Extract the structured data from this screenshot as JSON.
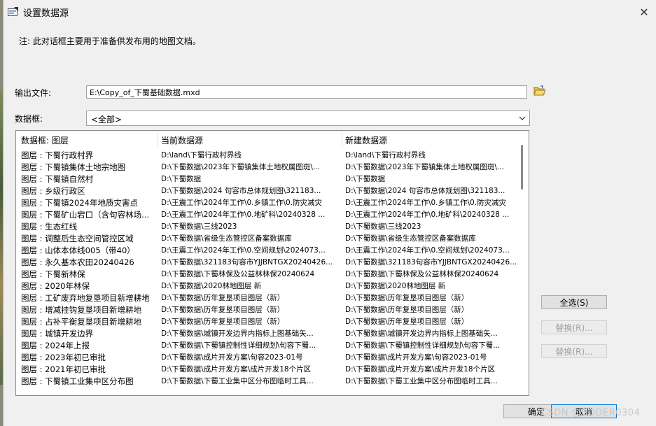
{
  "window": {
    "title": "设置数据源",
    "close_icon": "close-icon"
  },
  "note": "注: 此对话框主要用于准备供发布用的地图文档。",
  "output_file": {
    "label": "输出文件:",
    "value": "E:\\Copy_of_下蜀基础数据.mxd"
  },
  "data_frame": {
    "label": "数据框:",
    "value": "<全部>"
  },
  "table": {
    "columns": [
      "数据框: 图层",
      "当前数据源",
      "新建数据源"
    ],
    "rows": [
      [
        "图层 : 下蜀行政村界",
        "D:\\land\\下蜀行政村界线",
        "D:\\land\\下蜀行政村界线"
      ],
      [
        "图层 : 下蜀镇集体土地宗地图",
        "D:\\下蜀数据\\2023年下蜀镇集体土地权属图斑\\...",
        "D:\\下蜀数据\\2023年下蜀镇集体土地权属图斑\\..."
      ],
      [
        "图层 : 下蜀镇自然村",
        "D:\\下蜀数据",
        "D:\\下蜀数据"
      ],
      [
        "图层 : 乡级行政区",
        "D:\\下蜀数据\\2024 句容市总体规划图\\321183...",
        "D:\\下蜀数据\\2024 句容市总体规划图\\321183..."
      ],
      [
        "图层 : 下蜀镇2024年地质灾害点",
        "D:\\王震工作\\2024年工作\\0.乡镇工作\\0.防灾减灾",
        "D:\\王震工作\\2024年工作\\0.乡镇工作\\0.防灾减灾"
      ],
      [
        "图层 : 下蜀矿山宕口（含句容林场...",
        "D:\\王震工作\\2024年工作\\0.地矿科\\20240328 ...",
        "D:\\王震工作\\2024年工作\\0.地矿科\\20240328 ..."
      ],
      [
        "图层 : 生态红线",
        "D:\\下蜀数据\\三线2023",
        "D:\\下蜀数据\\三线2023"
      ],
      [
        "图层 : 调整后生态空间管控区域",
        "D:\\下蜀数据\\省级生态管控区备案数据库",
        "D:\\下蜀数据\\省级生态管控区备案数据库"
      ],
      [
        "图层 : 山体本体线005（带40）",
        "D:\\王震工作\\2024年工作\\0.空间规划\\2024073...",
        "D:\\王震工作\\2024年工作\\0.空间规划\\2024073..."
      ],
      [
        "图层 : 永久基本农田20240426",
        "D:\\下蜀数据\\321183句容市YJJBNTGX20240426...",
        "D:\\下蜀数据\\321183句容市YJJBNTGX20240426..."
      ],
      [
        "图层 : 下蜀新林保",
        "D:\\下蜀数据\\下蜀林保及公益林林保20240624",
        "D:\\下蜀数据\\下蜀林保及公益林林保20240624"
      ],
      [
        "图层 : 2020年林保",
        "D:\\下蜀数据\\2020林地图层 新",
        "D:\\下蜀数据\\2020林地图层 新"
      ],
      [
        "图层 : 工矿废弃地复垦项目新增耕地",
        "D:\\下蜀数据\\历年复垦项目图层（新）",
        "D:\\下蜀数据\\历年复垦项目图层（新）"
      ],
      [
        "图层 : 增减挂钩复垦项目新增耕地",
        "D:\\下蜀数据\\历年复垦项目图层（新）",
        "D:\\下蜀数据\\历年复垦项目图层（新）"
      ],
      [
        "图层 : 占补平衡复垦项目新增耕地",
        "D:\\下蜀数据\\历年复垦项目图层（新）",
        "D:\\下蜀数据\\历年复垦项目图层（新）"
      ],
      [
        "图层 : 城镇开发边界",
        "D:\\下蜀数据\\城镇开发边界内指标上图基础矢...",
        "D:\\下蜀数据\\城镇开发边界内指标上图基础矢..."
      ],
      [
        "图层 : 2024年上报",
        "D:\\下蜀数据\\下蜀镇控制性详细规划\\句容下蜀...",
        "D:\\下蜀数据\\下蜀镇控制性详细规划\\句容下蜀..."
      ],
      [
        "图层 : 2023年初已审批",
        "D:\\下蜀数据\\成片开发方案\\句容2023-01号",
        "D:\\下蜀数据\\成片开发方案\\句容2023-01号"
      ],
      [
        "图层 : 2021年初已审批",
        "D:\\下蜀数据\\成片开发方案\\成片开发18个片区",
        "D:\\下蜀数据\\成片开发方案\\成片开发18个片区"
      ],
      [
        "图层 : 下蜀镇工业集中区分布图",
        "D:\\下蜀数据\\下蜀工业集中区分布图临时工具...",
        "D:\\下蜀数据\\下蜀工业集中区分布图临时工具..."
      ]
    ]
  },
  "buttons": {
    "select_all": "全选(S)",
    "replace1": "替换(R)...",
    "replace2": "替换(R)...",
    "ok": "确定",
    "cancel": "取消"
  },
  "watermark": "CSDN @CODER0304"
}
